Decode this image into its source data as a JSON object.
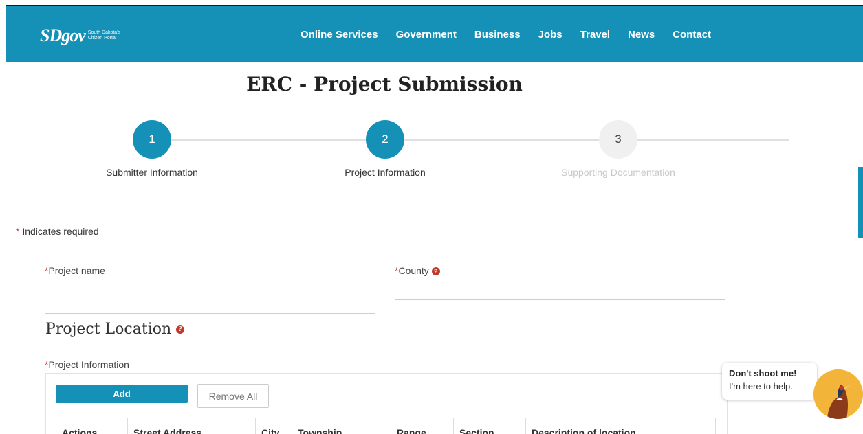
{
  "header": {
    "logo": {
      "main": "SDgov",
      "sub_line1": "South Dakota's",
      "sub_line2": "Citizen Portal"
    },
    "nav": [
      "Online Services",
      "Government",
      "Business",
      "Jobs",
      "Travel",
      "News",
      "Contact"
    ]
  },
  "page": {
    "title": "ERC - Project Submission"
  },
  "stepper": {
    "steps": [
      {
        "number": "1",
        "label": "Submitter Information",
        "state": "complete"
      },
      {
        "number": "2",
        "label": "Project Information",
        "state": "current"
      },
      {
        "number": "3",
        "label": "Supporting Documentation",
        "state": "upcoming"
      }
    ]
  },
  "form": {
    "required_marker": "*",
    "required_note": "Indicates required",
    "project_name_label": "Project name",
    "county_label": "County",
    "help_glyph": "?",
    "section_title": "Project Location",
    "project_info_label": "Project Information",
    "add_label": "Add",
    "remove_all_label": "Remove All",
    "table_headers": [
      "Actions",
      "Street Address",
      "City",
      "Township",
      "Range",
      "Section",
      "Description of location"
    ]
  },
  "chat": {
    "line1": "Don't shoot me!",
    "line2": "I'm here to help."
  },
  "colors": {
    "brand": "#1591b8",
    "required": "#d23b3b",
    "help_icon": "#c0392b"
  }
}
